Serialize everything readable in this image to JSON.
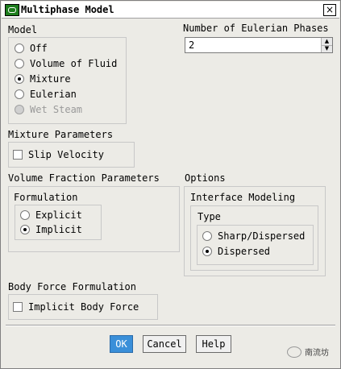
{
  "window": {
    "title": "Multiphase Model",
    "close": "×"
  },
  "model": {
    "label": "Model",
    "options": [
      {
        "label": "Off",
        "selected": false,
        "disabled": false
      },
      {
        "label": "Volume of Fluid",
        "selected": false,
        "disabled": false
      },
      {
        "label": "Mixture",
        "selected": true,
        "disabled": false
      },
      {
        "label": "Eulerian",
        "selected": false,
        "disabled": false
      },
      {
        "label": "Wet Steam",
        "selected": false,
        "disabled": true
      }
    ]
  },
  "eulerian_phases": {
    "label": "Number of Eulerian Phases",
    "value": "2"
  },
  "mixture_params": {
    "label": "Mixture Parameters",
    "slip_velocity": {
      "label": "Slip Velocity",
      "checked": false
    }
  },
  "volume_fraction": {
    "label": "Volume Fraction Parameters",
    "formulation_label": "Formulation",
    "options": [
      {
        "label": "Explicit",
        "selected": false
      },
      {
        "label": "Implicit",
        "selected": true
      }
    ]
  },
  "options": {
    "label": "Options",
    "interface_modeling_label": "Interface Modeling",
    "type_label": "Type",
    "types": [
      {
        "label": "Sharp/Dispersed",
        "selected": false
      },
      {
        "label": "Dispersed",
        "selected": true
      }
    ]
  },
  "body_force": {
    "label": "Body Force Formulation",
    "implicit": {
      "label": "Implicit Body Force",
      "checked": false
    }
  },
  "buttons": {
    "ok": "OK",
    "cancel": "Cancel",
    "help": "Help"
  },
  "watermark": "南流坊"
}
